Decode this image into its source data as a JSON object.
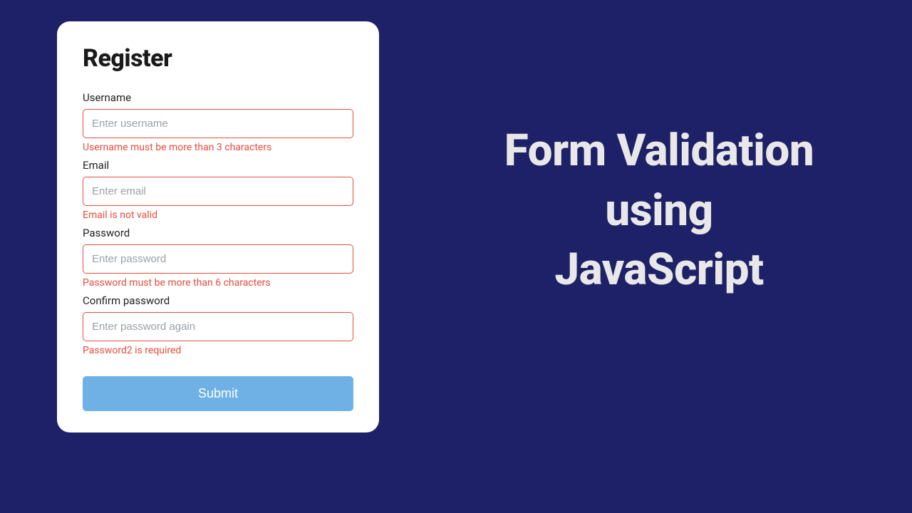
{
  "form": {
    "title": "Register",
    "fields": {
      "username": {
        "label": "Username",
        "placeholder": "Enter username",
        "error": "Username must be more than 3 characters"
      },
      "email": {
        "label": "Email",
        "placeholder": "Enter email",
        "error": "Email is not valid"
      },
      "password": {
        "label": "Password",
        "placeholder": "Enter password",
        "error": "Password must be more than 6 characters"
      },
      "confirm": {
        "label": "Confirm password",
        "placeholder": "Enter password again",
        "error": "Password2 is required"
      }
    },
    "submit_label": "Submit"
  },
  "headline": {
    "line1": "Form Validation",
    "line2": "using",
    "line3": "JavaScript"
  },
  "colors": {
    "background": "#1e2167",
    "error": "#e74c3c",
    "button": "#6fb1e4"
  }
}
